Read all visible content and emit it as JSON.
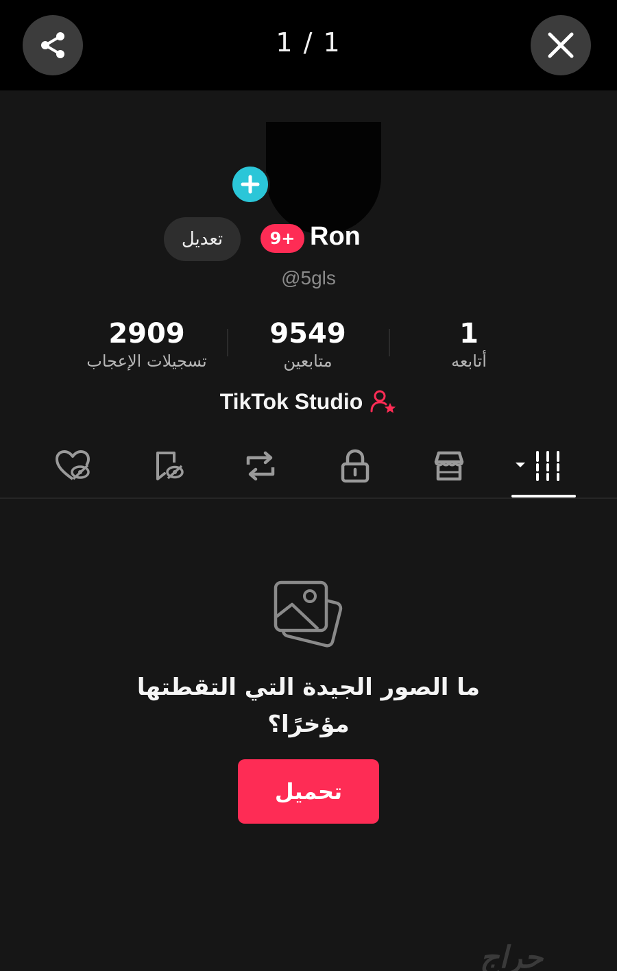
{
  "viewer": {
    "page_counter": "1 / 1",
    "share_icon": "share-icon",
    "close_icon": "close-icon"
  },
  "profile": {
    "avatar_add_icon": "plus-icon",
    "edit_label": "تعديل",
    "notification_badge": "9+",
    "name": "Ron",
    "handle": "@5gls"
  },
  "stats": {
    "likes": {
      "value": "2909",
      "label": "تسجيلات الإعجاب"
    },
    "followers": {
      "value": "9549",
      "label": "متابعين"
    },
    "following": {
      "value": "1",
      "label": "أتابعه"
    }
  },
  "studio": {
    "label": "TikTok Studio",
    "icon": "user-star-icon"
  },
  "tabs": [
    {
      "name": "liked-hidden",
      "icon": "heart-hidden-icon"
    },
    {
      "name": "favorites-hidden",
      "icon": "bookmark-hidden-icon"
    },
    {
      "name": "reposts",
      "icon": "repost-icon"
    },
    {
      "name": "private",
      "icon": "lock-icon"
    },
    {
      "name": "shop",
      "icon": "shop-icon"
    },
    {
      "name": "videos",
      "icon": "grid-icon",
      "selected": true
    }
  ],
  "empty_state": {
    "icon": "photos-icon",
    "title": "ما الصور الجيدة التي التقطتها مؤخرًا؟",
    "upload_label": "تحميل"
  },
  "watermark": "حراج",
  "colors": {
    "accent": "#fe2c55",
    "add_button": "#2bc6d8",
    "background": "#161616",
    "topbar": "#000000"
  }
}
